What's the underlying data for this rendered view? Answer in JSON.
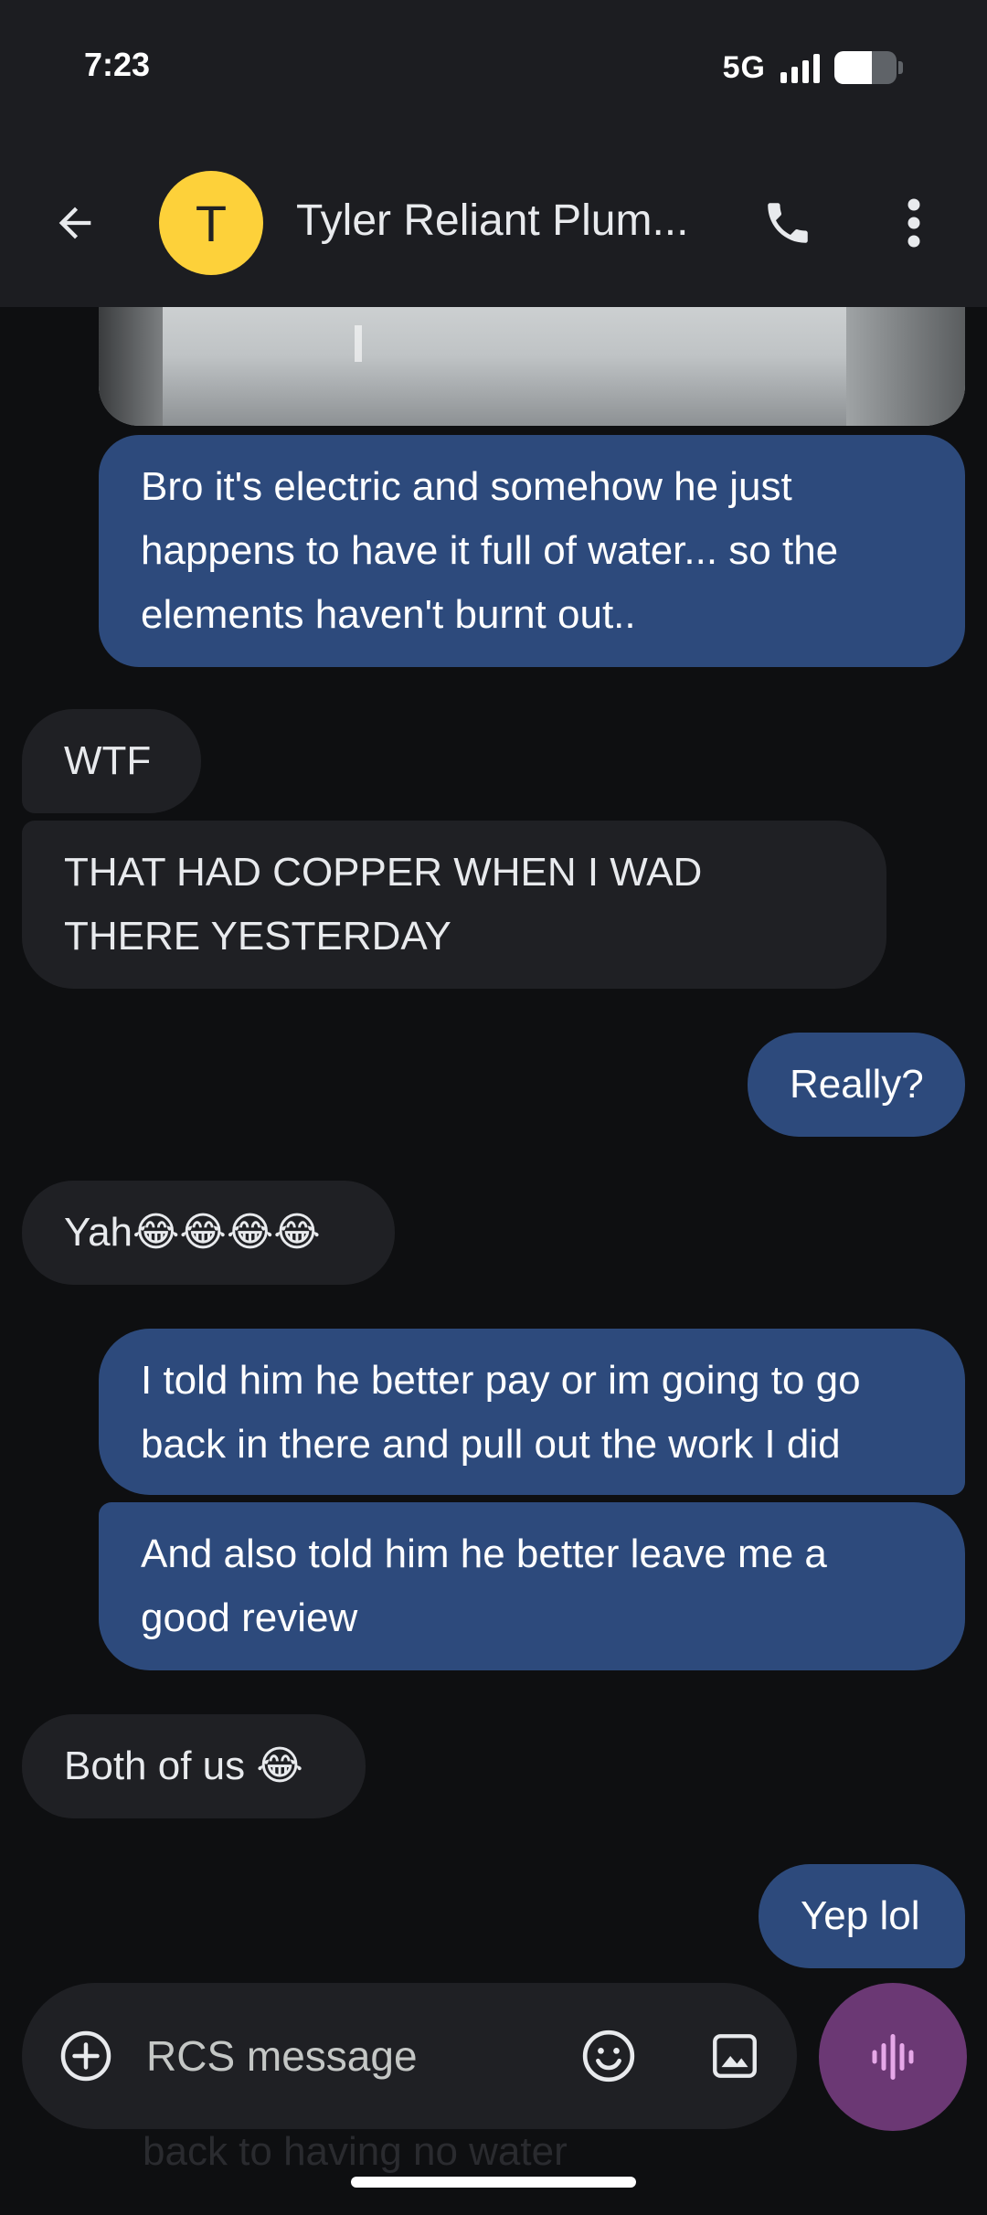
{
  "status_bar": {
    "time": "7:23",
    "network": "5G",
    "signal_bars": 4,
    "battery_level": 0.6
  },
  "app_bar": {
    "back_icon": "arrow-back-icon",
    "avatar_letter": "T",
    "avatar_color": "#fdd13a",
    "contact_name": "Tyler Reliant Plum...",
    "call_icon": "phone-icon",
    "more_icon": "more-vert-icon"
  },
  "messages": [
    {
      "direction": "out",
      "text": "Bro it's electric and somehow he just happens to have it full of water... so the elements haven't burnt out.."
    },
    {
      "direction": "in",
      "text": "WTF"
    },
    {
      "direction": "in",
      "text": "THAT HAD COPPER WHEN I WAD THERE YESTERDAY"
    },
    {
      "direction": "out",
      "text": "Really?"
    },
    {
      "direction": "in",
      "text": "Yah😂😂😂😂"
    },
    {
      "direction": "out",
      "text": "I told him he better pay or im going to go back in there and pull out the work I did"
    },
    {
      "direction": "out",
      "text": "And also told him he better leave me a good review"
    },
    {
      "direction": "in",
      "text": "Both of us 😂"
    },
    {
      "direction": "out",
      "text": "Yep lol"
    }
  ],
  "compose": {
    "placeholder": "RCS message",
    "add_icon": "add-circle-icon",
    "emoji_icon": "emoji-icon",
    "gallery_icon": "image-icon",
    "voice_icon": "voice-waveform-icon",
    "voice_color": "#6b3874",
    "ghost_text": "back to having no water"
  },
  "colors": {
    "background": "#0e0f11",
    "outgoing_bubble": "#2d4a7c",
    "incoming_bubble": "#1f2024"
  }
}
